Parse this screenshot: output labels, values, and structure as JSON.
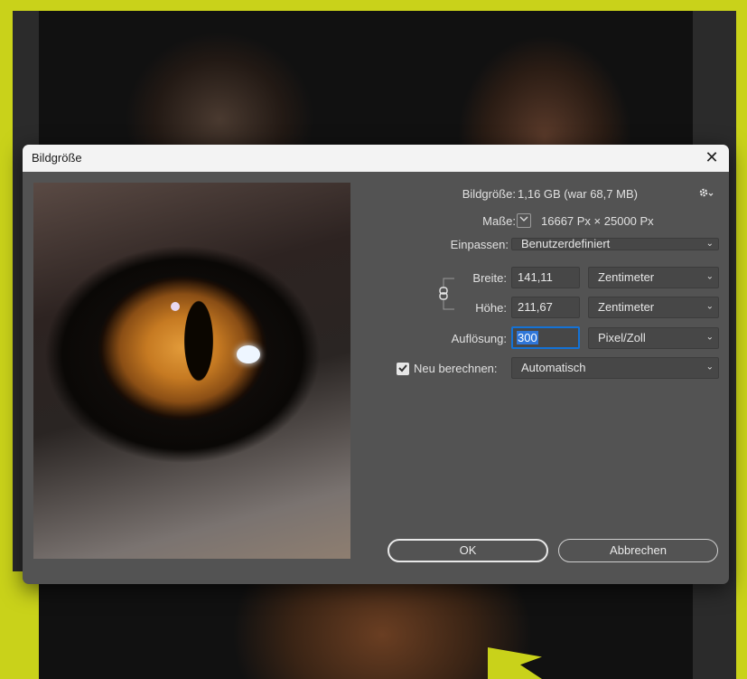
{
  "dialog": {
    "title": "Bildgröße",
    "close_glyph": "✕",
    "settings_icon": "gear-icon",
    "image_size_label": "Bildgröße:",
    "image_size_value": "1,16 GB (war 68,7 MB)",
    "dimensions_label": "Maße:",
    "dimensions_value": "16667 Px  ×  25000 Px",
    "fit_label": "Einpassen:",
    "fit_value": "Benutzerdefiniert",
    "width_label": "Breite:",
    "width_value": "141,11",
    "width_unit": "Zentimeter",
    "height_label": "Höhe:",
    "height_value": "211,67",
    "height_unit": "Zentimeter",
    "resolution_label": "Auflösung:",
    "resolution_value": "300",
    "resolution_unit": "Pixel/Zoll",
    "resample_label": "Neu berechnen:",
    "resample_checked": true,
    "resample_value": "Automatisch",
    "ok_label": "OK",
    "cancel_label": "Abbrechen"
  },
  "colors": {
    "frame": "#c9d21a",
    "dialog_bg": "#535353",
    "focus": "#1472d6"
  }
}
